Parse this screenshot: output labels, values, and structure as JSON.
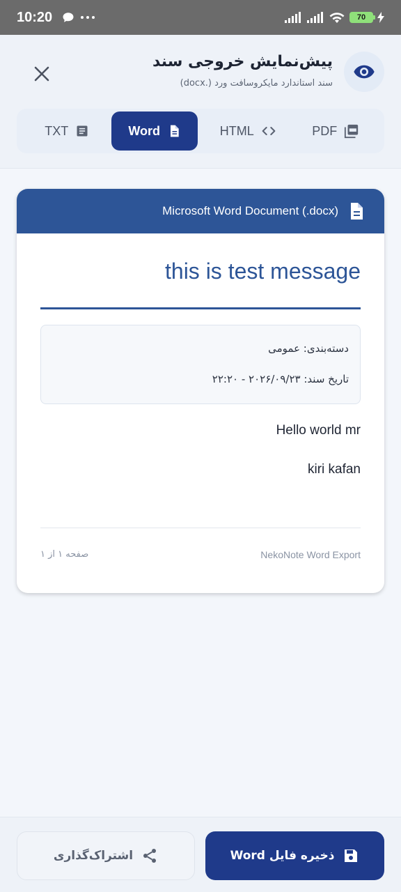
{
  "status_bar": {
    "time": "10:20",
    "battery": "70"
  },
  "header": {
    "title": "پیش‌نمایش خروجی سند",
    "subtitle": "سند استاندارد مایکروسافت ورد (.docx)"
  },
  "tabs": [
    {
      "label": "TXT",
      "icon": "text-file-icon",
      "active": false
    },
    {
      "label": "Word",
      "icon": "document-icon",
      "active": true
    },
    {
      "label": "HTML",
      "icon": "code-icon",
      "active": false
    },
    {
      "label": "PDF",
      "icon": "pdf-icon",
      "active": false
    }
  ],
  "document": {
    "header_label": "Microsoft Word Document (.docx)",
    "title": "this is test message",
    "category": "دسته‌بندی: عمومی",
    "date": "تاریخ سند: ۲۰۲۶/۰۹/۲۳ - ۲۲:۲۰",
    "body": [
      "Hello world mr",
      "kiri kafan"
    ],
    "footer_left": "صفحه ۱ از ۱",
    "footer_right": "NekoNote Word Export"
  },
  "actions": {
    "share_label": "اشتراک‌گذاری",
    "save_label": "ذخیره فایل Word"
  },
  "colors": {
    "accent": "#1f3a8a",
    "doc_blue": "#2d5597"
  }
}
